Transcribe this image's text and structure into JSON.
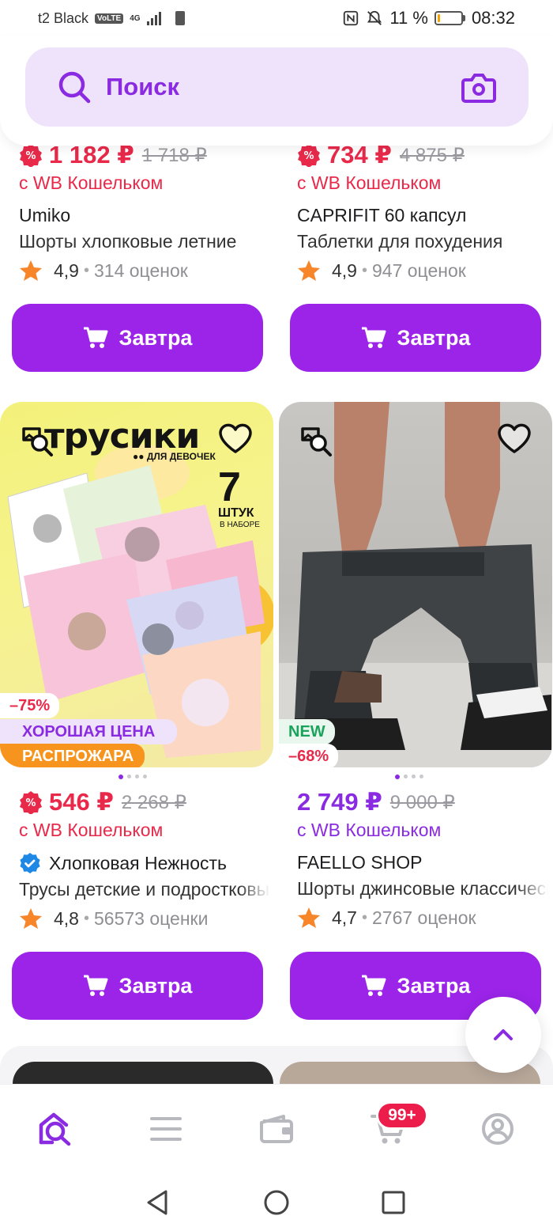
{
  "status_bar": {
    "carrier": "t2 Black",
    "volte": "VoLTE",
    "network": "4G",
    "battery_percent": "11 %",
    "battery_level": 0.11,
    "time": "08:32"
  },
  "search": {
    "placeholder": "Поиск"
  },
  "products": [
    {
      "price": "1 182 ₽",
      "old_price": "1 718 ₽",
      "wallet": "с WB Кошельком",
      "brand": "Umiko",
      "title": "Шорты хлопковые летние",
      "rating": "4,9",
      "reviews": "314 оценок",
      "button": "Завтра"
    },
    {
      "price": "734 ₽",
      "old_price": "4 875 ₽",
      "wallet": "с WB Кошельком",
      "brand": "CAPRIFIT 60 капсул",
      "title": "Таблетки для похудения",
      "rating": "4,9",
      "reviews": "947 оценок",
      "button": "Завтра"
    },
    {
      "image_title": "трусики",
      "image_subtitle": "●● ДЛЯ ДЕВОЧЕК",
      "image_count": "7",
      "image_count_label": "ШТУК",
      "image_count_sub": "В НАБОРЕ",
      "tags": [
        "–75%",
        "ХОРОШАЯ ЦЕНА",
        "РАСПРОЖАРА"
      ],
      "price": "546 ₽",
      "old_price": "2 268 ₽",
      "wallet": "с WB Кошельком",
      "brand": "Хлопковая Нежность",
      "title": "Трусы детские и подростковые",
      "rating": "4,8",
      "reviews": "56573 оценки",
      "button": "Завтра"
    },
    {
      "tags": [
        "NEW",
        "–68%"
      ],
      "price": "2 749 ₽",
      "old_price": "9 000 ₽",
      "wallet": "с WB Кошельком",
      "brand": "FAELLO SHOP",
      "title": "Шорты джинсовые классические",
      "rating": "4,7",
      "reviews": "2767 оценок",
      "button": "Завтра"
    }
  ],
  "bottom_nav": {
    "cart_badge": "99+",
    "items": [
      "home-icon",
      "catalog-icon",
      "wallet-icon",
      "cart-icon",
      "profile-icon"
    ]
  },
  "colors": {
    "brand_violet": "#8a2be2",
    "button_violet": "#9b24e8",
    "price_red": "#e8294a",
    "search_bg": "#efe3fb"
  }
}
